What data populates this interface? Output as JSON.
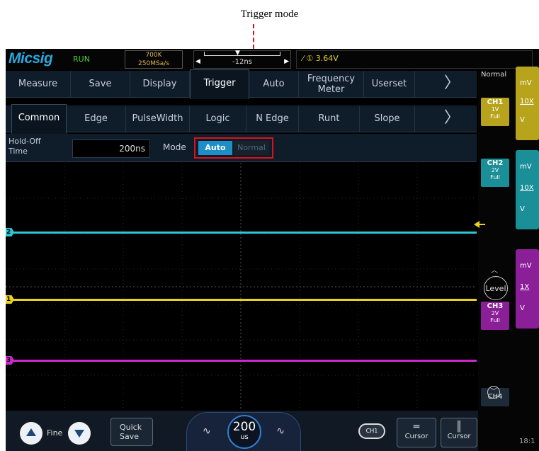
{
  "annotation": {
    "label": "Trigger mode"
  },
  "top_bar": {
    "logo": "Micsig",
    "run_state": "RUN",
    "memory_depth": "700K",
    "sample_rate": "250MSa/s",
    "time_offset": "-12ns",
    "trigger_source": "①",
    "trigger_level": "3.64V"
  },
  "menu_row_1": {
    "items": [
      "Measure",
      "Save",
      "Display",
      "Trigger",
      "Auto",
      "Frequency Meter",
      "Userset"
    ],
    "selected": "Trigger",
    "more": "〉"
  },
  "menu_row_2": {
    "items": [
      "Common",
      "Edge",
      "PulseWidth",
      "Logic",
      "N Edge",
      "Runt",
      "Slope"
    ],
    "selected": "Common",
    "more": "〉"
  },
  "trigger_params": {
    "holdoff_label_1": "Hold-Off",
    "holdoff_label_2": "Time",
    "holdoff_value": "200ns",
    "mode_label": "Mode",
    "mode_options": [
      "Auto",
      "Normal"
    ],
    "mode_selected": "Auto"
  },
  "traces": [
    {
      "channel": "2",
      "color": "#2ec6d4"
    },
    {
      "channel": "1",
      "color": "#e8d21d"
    },
    {
      "channel": "3",
      "color": "#d028d0"
    }
  ],
  "right_panel": {
    "trigger_mode_status": "Normal",
    "ch1": {
      "label": "CH1",
      "scale": "1V",
      "bw": "Full",
      "color": "#b8a41c"
    },
    "ch2": {
      "label": "CH2",
      "scale": "2V",
      "bw": "Full",
      "color": "#1a8f97"
    },
    "ch3": {
      "label": "CH3",
      "scale": "2V",
      "bw": "Full",
      "color": "#8b1f98"
    },
    "ch4": {
      "label": "CH4"
    },
    "ch1_card": {
      "unit": "mV",
      "probe": "10X",
      "unit2": "V"
    },
    "ch2_card": {
      "unit": "mV",
      "probe": "10X",
      "unit2": "V"
    },
    "ch3_card": {
      "unit": "mV",
      "probe": "1X",
      "unit2": "V"
    },
    "level_button": "Level",
    "clock": "18:1"
  },
  "bottom_bar": {
    "fine_label": "Fine",
    "quick_save_1": "Quick",
    "quick_save_2": "Save",
    "timebase_value": "200",
    "timebase_unit": "us",
    "ch1_toggle": "CH1",
    "cursor_h_label": "Cursor",
    "cursor_v_label": "Cursor"
  }
}
